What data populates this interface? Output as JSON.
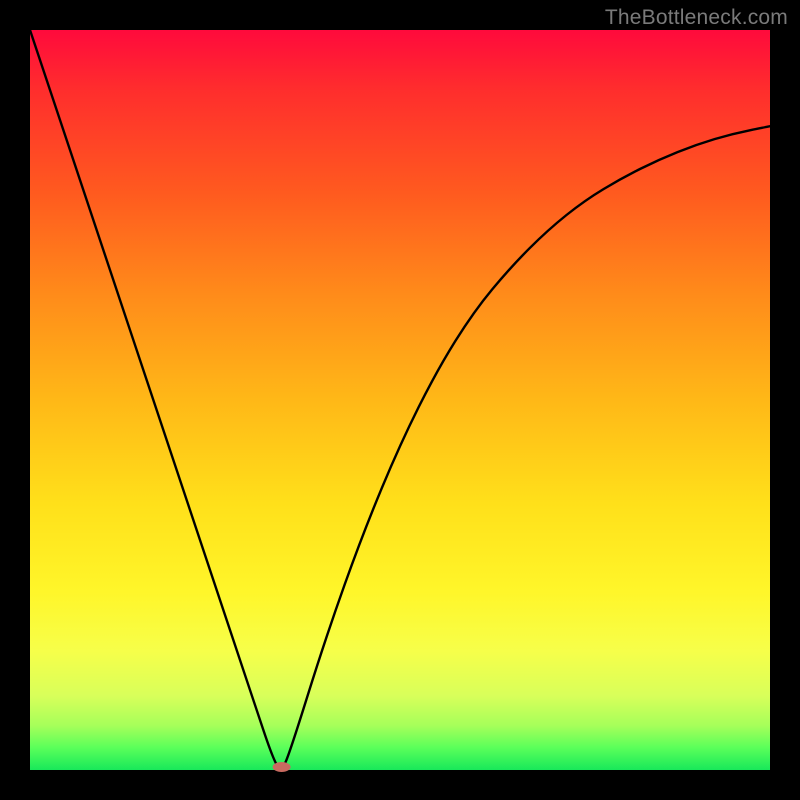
{
  "watermark": "TheBottleneck.com",
  "colors": {
    "frame": "#000000",
    "curve": "#000000",
    "marker": "#c86a60",
    "gradient_top": "#ff0a3c",
    "gradient_bottom": "#18e85a"
  },
  "chart_data": {
    "type": "line",
    "title": "",
    "xlabel": "",
    "ylabel": "",
    "xlim": [
      0,
      100
    ],
    "ylim": [
      0,
      100
    ],
    "series": [
      {
        "name": "bottleneck-curve",
        "x": [
          0,
          5,
          10,
          15,
          20,
          25,
          30,
          33,
          34,
          35,
          40,
          45,
          50,
          55,
          60,
          65,
          70,
          75,
          80,
          85,
          90,
          95,
          100
        ],
        "values": [
          100,
          85,
          70,
          55,
          40,
          25,
          10,
          1,
          0,
          2,
          18,
          32,
          44,
          54,
          62,
          68,
          73,
          77,
          80,
          82.5,
          84.5,
          86,
          87
        ]
      }
    ],
    "marker": {
      "x": 34,
      "y": 0
    },
    "annotations": []
  }
}
